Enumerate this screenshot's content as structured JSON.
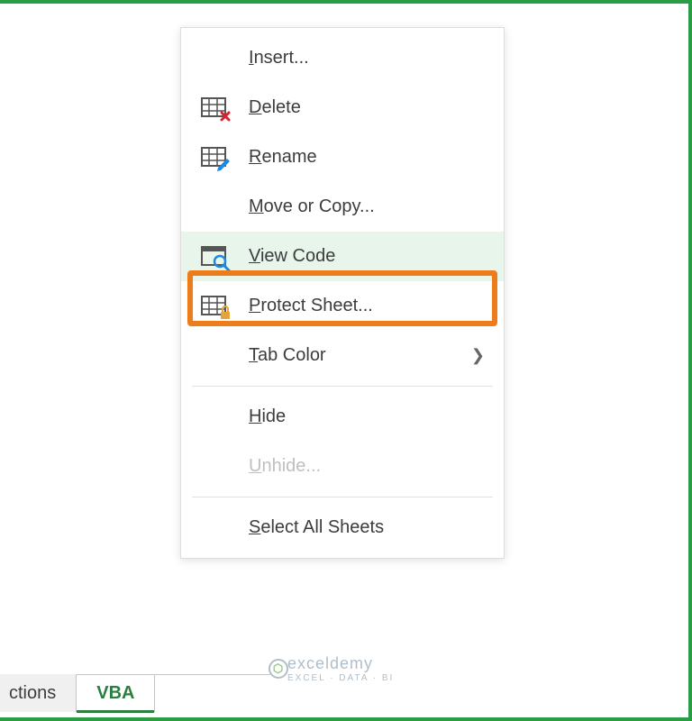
{
  "menu": {
    "insert": {
      "pre": "",
      "u": "I",
      "post": "nsert..."
    },
    "delete": {
      "pre": "",
      "u": "D",
      "post": "elete"
    },
    "rename": {
      "pre": "",
      "u": "R",
      "post": "ename"
    },
    "move_or_copy": {
      "pre": "",
      "u": "M",
      "post": "ove or Copy..."
    },
    "view_code": {
      "pre": "",
      "u": "V",
      "post": "iew Code"
    },
    "protect_sheet": {
      "pre": "",
      "u": "P",
      "post": "rotect Sheet..."
    },
    "tab_color": {
      "pre": "",
      "u": "T",
      "post": "ab Color"
    },
    "hide": {
      "pre": "",
      "u": "H",
      "post": "ide"
    },
    "unhide": {
      "pre": "",
      "u": "U",
      "post": "nhide..."
    },
    "select_all": {
      "pre": "",
      "u": "S",
      "post": "elect All Sheets"
    }
  },
  "tabs": {
    "partial": "ctions",
    "active": "VBA"
  },
  "watermark": {
    "text": "exceldemy",
    "sub": "EXCEL · DATA · BI"
  }
}
